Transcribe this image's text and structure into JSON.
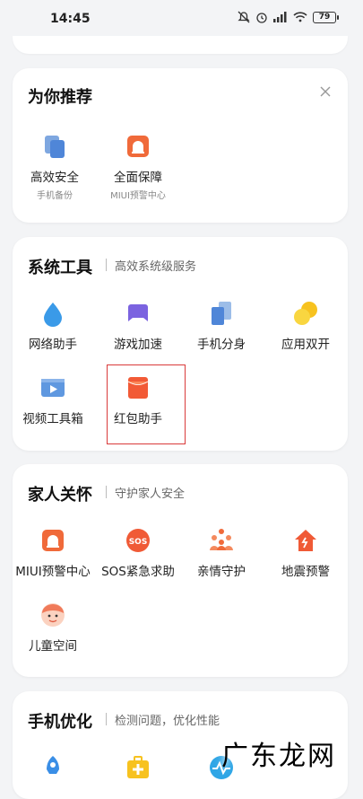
{
  "status_bar": {
    "time": "14:45",
    "battery": "79"
  },
  "recommend": {
    "title": "为你推荐",
    "items": [
      {
        "label": "高效安全",
        "sub": "手机备份",
        "icon": "backup-icon"
      },
      {
        "label": "全面保障",
        "sub": "MIUI预警中心",
        "icon": "alert-icon"
      }
    ]
  },
  "system_tools": {
    "title": "系统工具",
    "subtitle": "高效系统级服务",
    "items": [
      {
        "label": "网络助手",
        "icon": "network-drop-icon"
      },
      {
        "label": "游戏加速",
        "icon": "game-icon"
      },
      {
        "label": "手机分身",
        "icon": "phone-clone-icon"
      },
      {
        "label": "应用双开",
        "icon": "dual-apps-icon"
      },
      {
        "label": "视频工具箱",
        "icon": "video-toolbox-icon"
      },
      {
        "label": "红包助手",
        "icon": "red-envelope-icon"
      }
    ]
  },
  "family_care": {
    "title": "家人关怀",
    "subtitle": "守护家人安全",
    "items": [
      {
        "label": "MIUI预警中心",
        "icon": "alert-icon"
      },
      {
        "label": "SOS紧急求助",
        "icon": "sos-icon"
      },
      {
        "label": "亲情守护",
        "icon": "family-icon"
      },
      {
        "label": "地震预警",
        "icon": "earthquake-icon"
      },
      {
        "label": "儿童空间",
        "icon": "kid-face-icon"
      }
    ]
  },
  "phone_optimize": {
    "title": "手机优化",
    "subtitle": "检测问题，优化性能"
  },
  "watermark": "广东龙网",
  "colors": {
    "accent_orange": "#f06a3a",
    "accent_blue": "#3a8ee6",
    "highlight_red": "#d93a3a"
  }
}
